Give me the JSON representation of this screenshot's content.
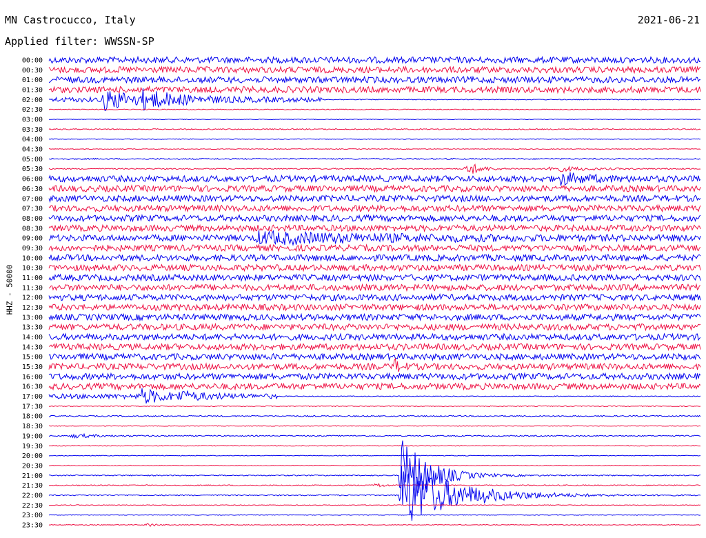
{
  "header": {
    "station": "MN Castrocucco, Italy",
    "date": "2021-06-21",
    "filter": "Applied filter: WWSSN-SP"
  },
  "chart_data": {
    "type": "helicorder",
    "ylabel": "HHZ - 50000",
    "colors": {
      "odd": "#0000ee",
      "even": "#ee1144"
    },
    "rows": [
      {
        "label": "00:00",
        "base": 4.5,
        "events": []
      },
      {
        "label": "00:30",
        "base": 4.5,
        "events": []
      },
      {
        "label": "01:00",
        "base": 4.5,
        "events": []
      },
      {
        "label": "01:30",
        "base": 4.5,
        "events": []
      },
      {
        "label": "02:00",
        "base": 3.5,
        "events": [
          {
            "t": 0.085,
            "amp": 14,
            "decay": 0.05
          },
          {
            "t": 0.14,
            "amp": 10,
            "decay": 0.06
          }
        ],
        "fade": 0.42
      },
      {
        "label": "02:30",
        "base": 0.6,
        "events": []
      },
      {
        "label": "03:00",
        "base": 0.5,
        "events": []
      },
      {
        "label": "03:30",
        "base": 0.8,
        "events": []
      },
      {
        "label": "04:00",
        "base": 0.5,
        "events": []
      },
      {
        "label": "04:30",
        "base": 0.5,
        "events": []
      },
      {
        "label": "05:00",
        "base": 0.9,
        "events": []
      },
      {
        "label": "05:30",
        "base": 0.8,
        "events": [
          {
            "t": 0.64,
            "amp": 12,
            "decay": 0.02
          },
          {
            "t": 0.765,
            "amp": 5,
            "decay": 0.05
          }
        ]
      },
      {
        "label": "06:00",
        "base": 4.5,
        "events": [
          {
            "t": 0.78,
            "amp": 8,
            "decay": 0.04
          }
        ]
      },
      {
        "label": "06:30",
        "base": 4.5,
        "events": []
      },
      {
        "label": "07:00",
        "base": 4.5,
        "events": []
      },
      {
        "label": "07:30",
        "base": 4.5,
        "events": []
      },
      {
        "label": "08:00",
        "base": 4.5,
        "events": []
      },
      {
        "label": "08:30",
        "base": 4.5,
        "events": []
      },
      {
        "label": "09:00",
        "base": 4.5,
        "events": [
          {
            "t": 0.32,
            "amp": 7,
            "decay": 0.2
          }
        ]
      },
      {
        "label": "09:30",
        "base": 4.5,
        "events": []
      },
      {
        "label": "10:00",
        "base": 4.5,
        "events": []
      },
      {
        "label": "10:30",
        "base": 4.5,
        "events": []
      },
      {
        "label": "11:00",
        "base": 4.5,
        "events": []
      },
      {
        "label": "11:30",
        "base": 4.5,
        "events": []
      },
      {
        "label": "12:00",
        "base": 4.5,
        "events": []
      },
      {
        "label": "12:30",
        "base": 4.5,
        "events": []
      },
      {
        "label": "13:00",
        "base": 4.5,
        "events": []
      },
      {
        "label": "13:30",
        "base": 4.5,
        "events": []
      },
      {
        "label": "14:00",
        "base": 4.5,
        "events": []
      },
      {
        "label": "14:30",
        "base": 4.5,
        "events": []
      },
      {
        "label": "15:00",
        "base": 4.5,
        "events": []
      },
      {
        "label": "15:30",
        "base": 4.5,
        "events": [
          {
            "t": 0.53,
            "amp": 9,
            "decay": 0.01
          }
        ]
      },
      {
        "label": "16:00",
        "base": 4.5,
        "events": []
      },
      {
        "label": "16:30",
        "base": 4.5,
        "events": []
      },
      {
        "label": "17:00",
        "base": 3.5,
        "events": [
          {
            "t": 0.14,
            "amp": 10,
            "decay": 0.04
          },
          {
            "t": 0.2,
            "amp": 5,
            "decay": 0.03
          }
        ],
        "fade": 0.35
      },
      {
        "label": "17:30",
        "base": 0.6,
        "events": []
      },
      {
        "label": "18:00",
        "base": 0.9,
        "events": []
      },
      {
        "label": "18:30",
        "base": 0.5,
        "events": []
      },
      {
        "label": "19:00",
        "base": 0.8,
        "events": [
          {
            "t": 0.035,
            "amp": 3,
            "decay": 0.04
          }
        ]
      },
      {
        "label": "19:30",
        "base": 0.6,
        "events": []
      },
      {
        "label": "20:00",
        "base": 0.5,
        "events": []
      },
      {
        "label": "20:30",
        "base": 0.5,
        "events": []
      },
      {
        "label": "21:00",
        "base": 0.8,
        "events": [
          {
            "t": 0.54,
            "amp": 60,
            "decay": 0.04
          }
        ]
      },
      {
        "label": "21:30",
        "base": 0.8,
        "events": [
          {
            "t": 0.5,
            "amp": 5,
            "decay": 0.01
          }
        ]
      },
      {
        "label": "22:00",
        "base": 0.8,
        "events": [
          {
            "t": 0.54,
            "amp": 50,
            "decay": 0.08
          }
        ]
      },
      {
        "label": "22:30",
        "base": 0.5,
        "events": []
      },
      {
        "label": "23:00",
        "base": 0.5,
        "events": []
      },
      {
        "label": "23:30",
        "base": 0.5,
        "events": [
          {
            "t": 0.15,
            "amp": 4,
            "decay": 0.01
          }
        ]
      }
    ]
  }
}
